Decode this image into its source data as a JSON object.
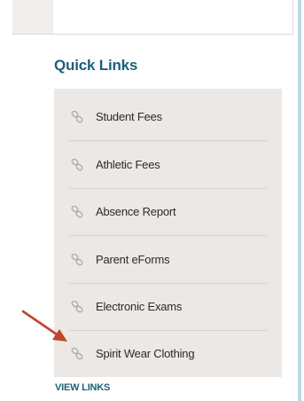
{
  "quick_links": {
    "title": "Quick Links",
    "items": [
      {
        "label": "Student Fees",
        "icon": "link-icon"
      },
      {
        "label": "Athletic Fees",
        "icon": "link-icon"
      },
      {
        "label": "Absence Report",
        "icon": "link-icon"
      },
      {
        "label": "Parent eForms",
        "icon": "link-icon"
      },
      {
        "label": "Electronic Exams",
        "icon": "link-icon"
      },
      {
        "label": "Spirit Wear Clothing",
        "icon": "link-icon"
      }
    ],
    "view_links_label": "VIEW LINKS"
  },
  "colors": {
    "accent": "#1d5f7b",
    "panel": "#ebe8e5",
    "annotation_arrow": "#c0452d"
  }
}
